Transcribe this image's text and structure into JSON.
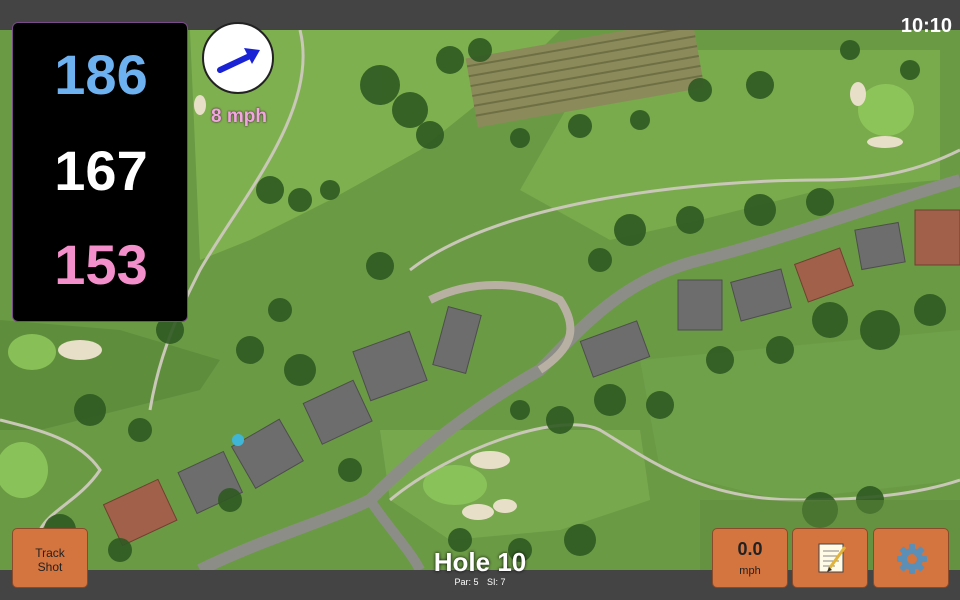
{
  "status_bar": {
    "time": "10:10"
  },
  "distances": {
    "back": "186",
    "middle": "167",
    "front": "153"
  },
  "wind": {
    "speed_label": "8 mph",
    "icon": "wind-direction-arrow-icon"
  },
  "buttons": {
    "track_shot_line1": "Track",
    "track_shot_line2": "Shot",
    "speed_value": "0.0",
    "speed_unit": "mph",
    "notes_icon": "notepad-icon",
    "settings_icon": "gear-icon"
  },
  "hole": {
    "title": "Hole 10",
    "par": "Par: 5",
    "si": "SI: 7"
  },
  "colors": {
    "back": "#6eb1f0",
    "middle": "#ffffff",
    "front": "#f38fcb",
    "button": "#d4743f",
    "wind_text": "#f1a6e0"
  }
}
